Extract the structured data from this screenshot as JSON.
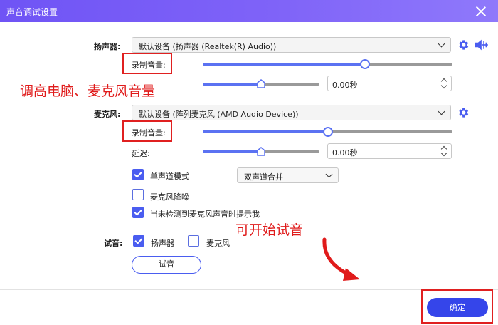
{
  "window": {
    "title": "声音调试设置"
  },
  "speaker": {
    "label": "扬声器:",
    "device": "默认设备 (扬声器 (Realtek(R) Audio))",
    "volume_label": "录制音量:",
    "volume_fraction": 0.65,
    "delay_fraction": 0.5,
    "delay_value": "0.00秒"
  },
  "microphone": {
    "label": "麦克风:",
    "device": "默认设备 (阵列麦克风 (AMD Audio Device))",
    "volume_label": "录制音量:",
    "volume_fraction": 0.5,
    "delay_label": "延迟:",
    "delay_fraction": 0.5,
    "delay_value": "0.00秒",
    "mono_label": "单声道模式",
    "mono_checked": true,
    "channel_mode": "双声道合并",
    "noise_label": "麦克风降噪",
    "noise_checked": false,
    "notify_label": "当未检测到麦克风声音时提示我",
    "notify_checked": true
  },
  "test": {
    "label": "试音:",
    "speaker_label": "扬声器",
    "speaker_checked": true,
    "mic_label": "麦克风",
    "mic_checked": false,
    "button": "试音"
  },
  "confirm_button": "确定",
  "annotations": {
    "raise_volume": "调高电脑、麦克风音量",
    "can_test": "可开始试音"
  },
  "icons": {
    "settings": "gear-icon",
    "speaker": "speaker-volume-icon",
    "close": "close-icon"
  },
  "colors": {
    "accent": "#5b72f2",
    "primary": "#3545ea",
    "annotation": "#e01b1b",
    "title_bar": "#7f63f8"
  }
}
